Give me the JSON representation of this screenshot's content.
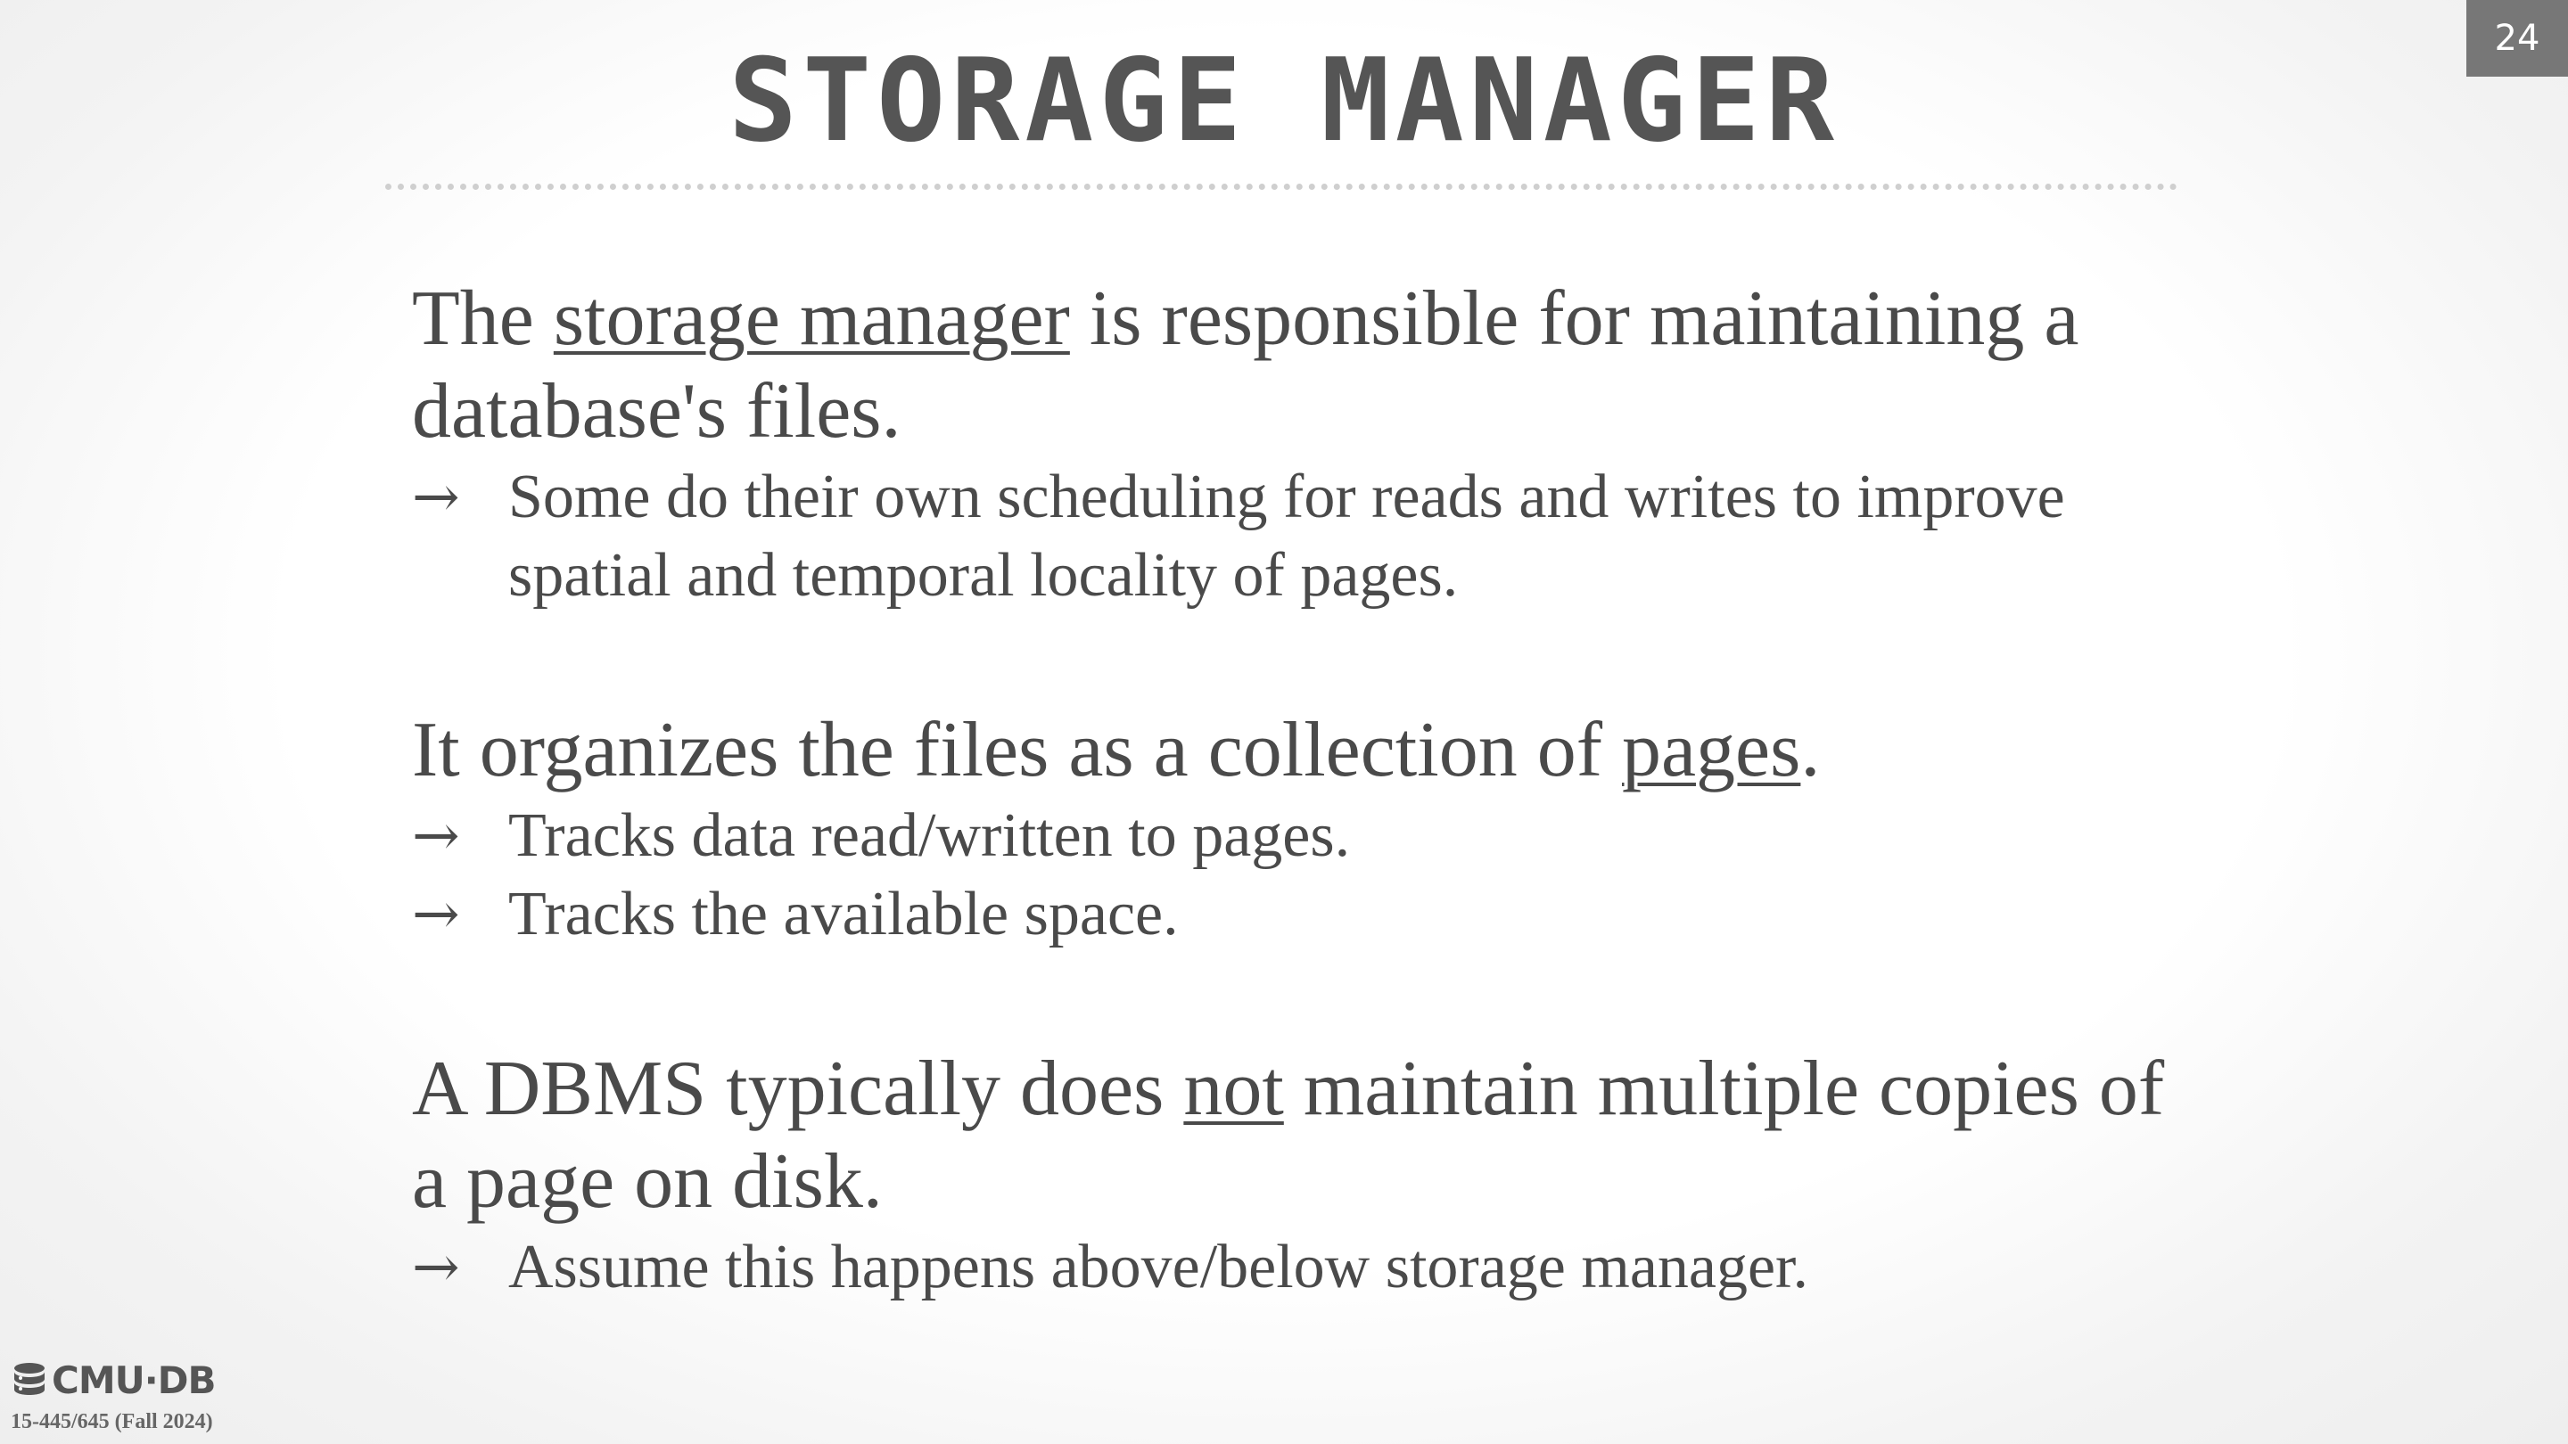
{
  "slide": {
    "number": "24",
    "title": "STORAGE MANAGER"
  },
  "content": {
    "block1": {
      "pre": "The ",
      "term": "storage manager",
      "post": " is responsible for maintaining a database's files.",
      "bullets": [
        "Some do their own scheduling for reads and writes to improve spatial and temporal locality of pages."
      ]
    },
    "block2": {
      "pre": "It organizes the files as a collection of ",
      "term": "pages",
      "post": ".",
      "bullets": [
        "Tracks data read/written to pages.",
        "Tracks the available space."
      ]
    },
    "block3": {
      "pre": "A DBMS typically does ",
      "term": "not",
      "post": " maintain multiple copies of a page on disk.",
      "bullets": [
        "Assume this happens above/below storage manager."
      ]
    },
    "arrow": "→"
  },
  "footer": {
    "logo_text": "CMU·DB",
    "logo_icon": "database-stack-icon",
    "course": "15-445/645 (Fall 2024)"
  }
}
